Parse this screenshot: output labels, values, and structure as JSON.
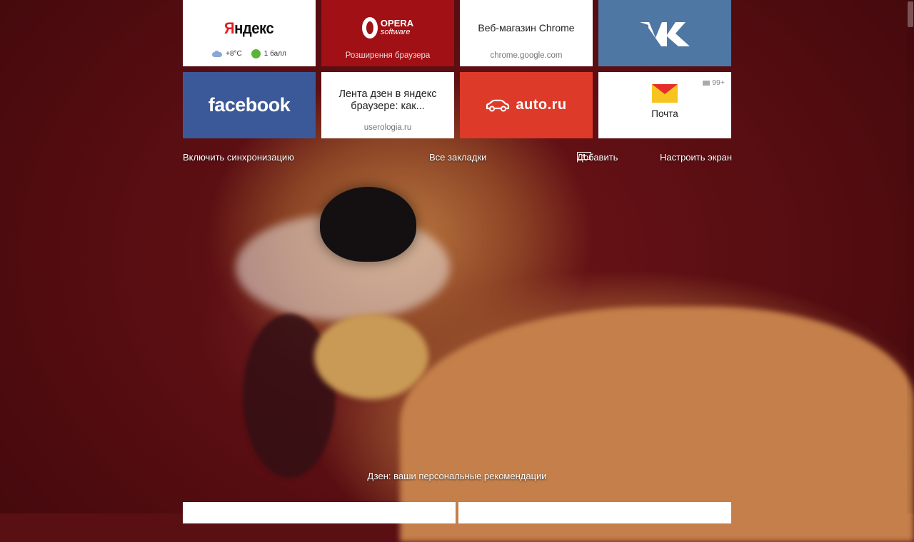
{
  "colors": {
    "opera_bg": "#a01014",
    "vk_bg": "#4f77a4",
    "facebook_bg": "#3b5998",
    "autoru_bg": "#de3a2a",
    "yandex_red": "#e31e24"
  },
  "tiles": {
    "yandex": {
      "logo_first": "Я",
      "logo_rest": "ндекс",
      "weather": "+8°С",
      "traffic": "1 балл",
      "weather_icon": "cloud-rain-icon",
      "traffic_icon": "traffic-dot-icon"
    },
    "opera": {
      "logo_top": "OPERA",
      "logo_bottom": "software",
      "subtitle": "Розширення браузера"
    },
    "chrome": {
      "title": "Веб-магазин Chrome",
      "subtitle": "chrome.google.com"
    },
    "vk": {
      "icon": "vk-logo-icon"
    },
    "facebook": {
      "label": "facebook"
    },
    "zen": {
      "title": "Лента дзен в яндекс браузере: как...",
      "subtitle": "userologia.ru"
    },
    "autoru": {
      "label": "auto.ru",
      "icon": "car-icon"
    },
    "mail": {
      "label": "Почта",
      "count": "99+",
      "icon": "mail-envelope-icon"
    }
  },
  "links": {
    "sync": "Включить синхронизацию",
    "bookmarks": "Все закладки",
    "add": "Добавить",
    "customize": "Настроить экран"
  },
  "zen_heading": "Дзен: ваши персональные рекомендации"
}
